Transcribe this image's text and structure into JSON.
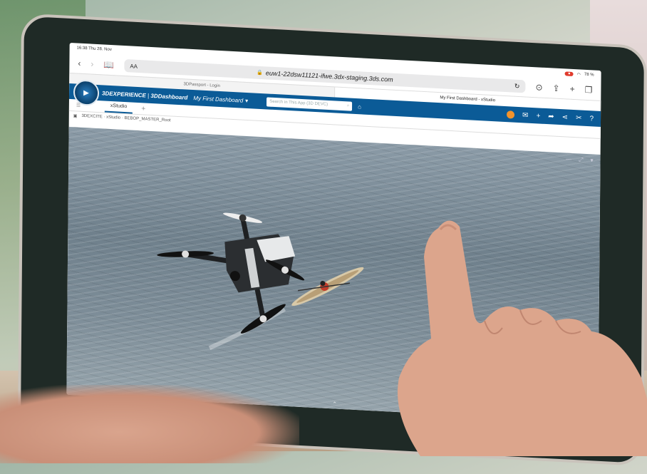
{
  "statusbar": {
    "time_date": "16:38  Thu 28. Nov",
    "battery": "78 %"
  },
  "browser": {
    "url": "euw1-22dsw11121-ifwe.3dx-staging.3ds.com",
    "text_size_label": "AA",
    "tabs": [
      {
        "label": "3DPassport - Login",
        "active": false
      },
      {
        "label": "My First Dashboard - xStudio",
        "active": true
      }
    ]
  },
  "dashboard": {
    "brand_prefix": "3DEXPERIENCE",
    "brand_app": "3DDashboard",
    "dashboard_name": "My First Dashboard",
    "search_placeholder": "Search in This App (3D DEVC)",
    "accent_color": "#0b5b97",
    "avatar_color": "#f3932b"
  },
  "workspace": {
    "tab_label": "xStudio",
    "object_path": "3DEXCITE · xStudio · BEBOP_MASTER_Root"
  },
  "viewport": {
    "scene": "drone over water with kayak"
  }
}
